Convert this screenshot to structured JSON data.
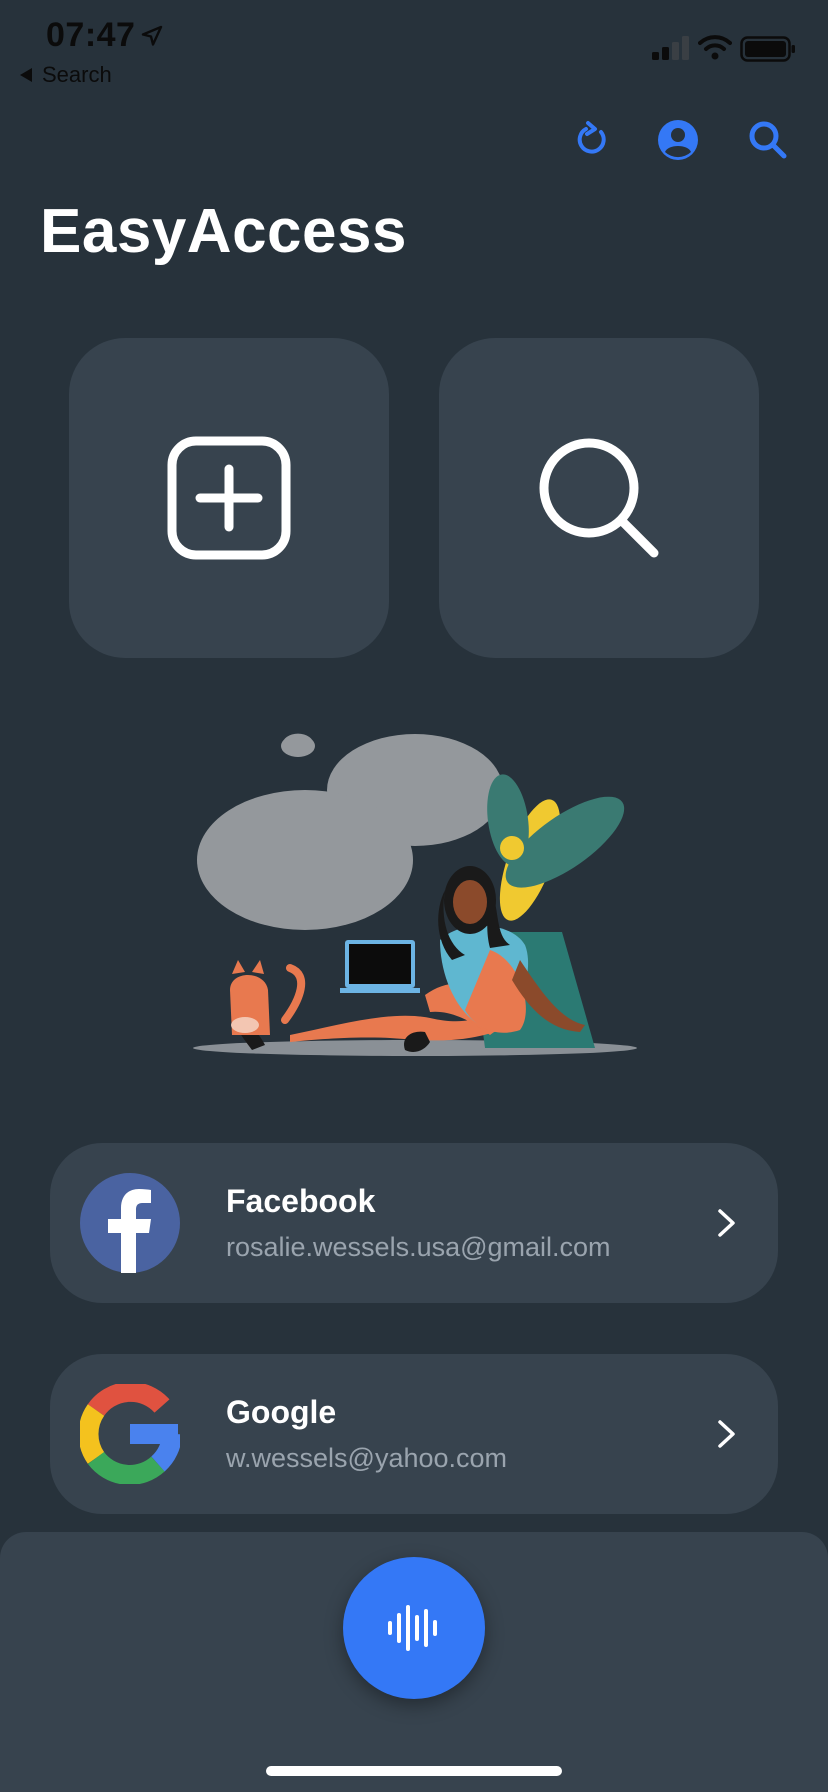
{
  "status_bar": {
    "time": "07:47",
    "back_label": "Search"
  },
  "header": {
    "title": "EasyAccess",
    "icons": [
      "refresh-icon",
      "profile-icon",
      "search-icon"
    ]
  },
  "tiles": [
    {
      "icon": "add-square-icon"
    },
    {
      "icon": "search-icon"
    }
  ],
  "accounts": [
    {
      "name": "Facebook",
      "email": "rosalie.wessels.usa@gmail.com",
      "icon": "facebook-logo"
    },
    {
      "name": "Google",
      "email": "w.wessels@yahoo.com",
      "icon": "google-logo"
    }
  ],
  "bottom": {
    "icon": "voice-waveform-icon"
  },
  "colors": {
    "background": "#27323b",
    "card": "#37434e",
    "accent": "#3478f6",
    "secondary_text": "#9aa4ae"
  }
}
